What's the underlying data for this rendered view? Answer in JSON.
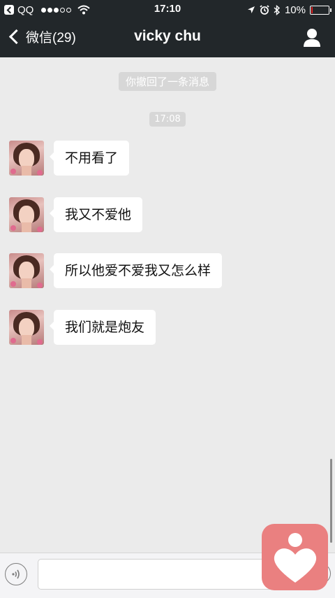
{
  "status_bar": {
    "carrier": "QQ",
    "time": "17:10",
    "battery": "10%",
    "battery_level": 0.1
  },
  "nav": {
    "back_label": "微信(29)",
    "title": "vicky chu"
  },
  "chat": {
    "recall_notice": "你撤回了一条消息",
    "timestamp": "17:08",
    "messages": [
      {
        "text": "不用看了"
      },
      {
        "text": "我又不爱他"
      },
      {
        "text": "所以他爱不爱我又怎么样"
      },
      {
        "text": "我们就是炮友"
      }
    ]
  },
  "colors": {
    "bar_bg": "#22272a",
    "chat_bg": "#ebebeb",
    "bubble_bg": "#ffffff",
    "logo": "#ea8080"
  },
  "icons": {
    "nav_profile": "person-icon",
    "input_voice": "voice-icon",
    "overlay": "heart-logo-icon"
  }
}
